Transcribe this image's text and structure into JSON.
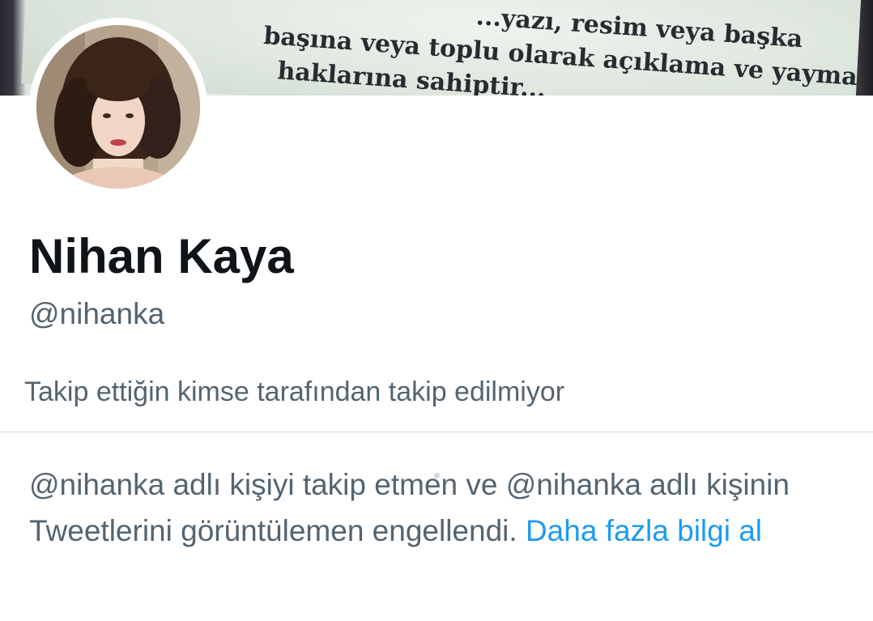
{
  "banner": {
    "lines": [
      "...yazı, resim veya başka",
      "başına veya toplu olarak açıklama ve yayma",
      "haklarına sahiptir..."
    ]
  },
  "profile": {
    "name": "Nihan Kaya",
    "handle": "@nihanka",
    "followed_by_text": "Takip ettiğin kimse tarafından takip edilmiyor"
  },
  "block_notice": {
    "message": "@nihanka adlı kişiyi takip etmen ve @nihanka adlı kişinin Tweetlerini görüntülemen engellendi.",
    "link_text": "Daha fazla bilgi al"
  },
  "colors": {
    "primary_text": "#0f1419",
    "secondary_text": "#536471",
    "link": "#1d9bf0",
    "divider": "#cfd9de"
  }
}
